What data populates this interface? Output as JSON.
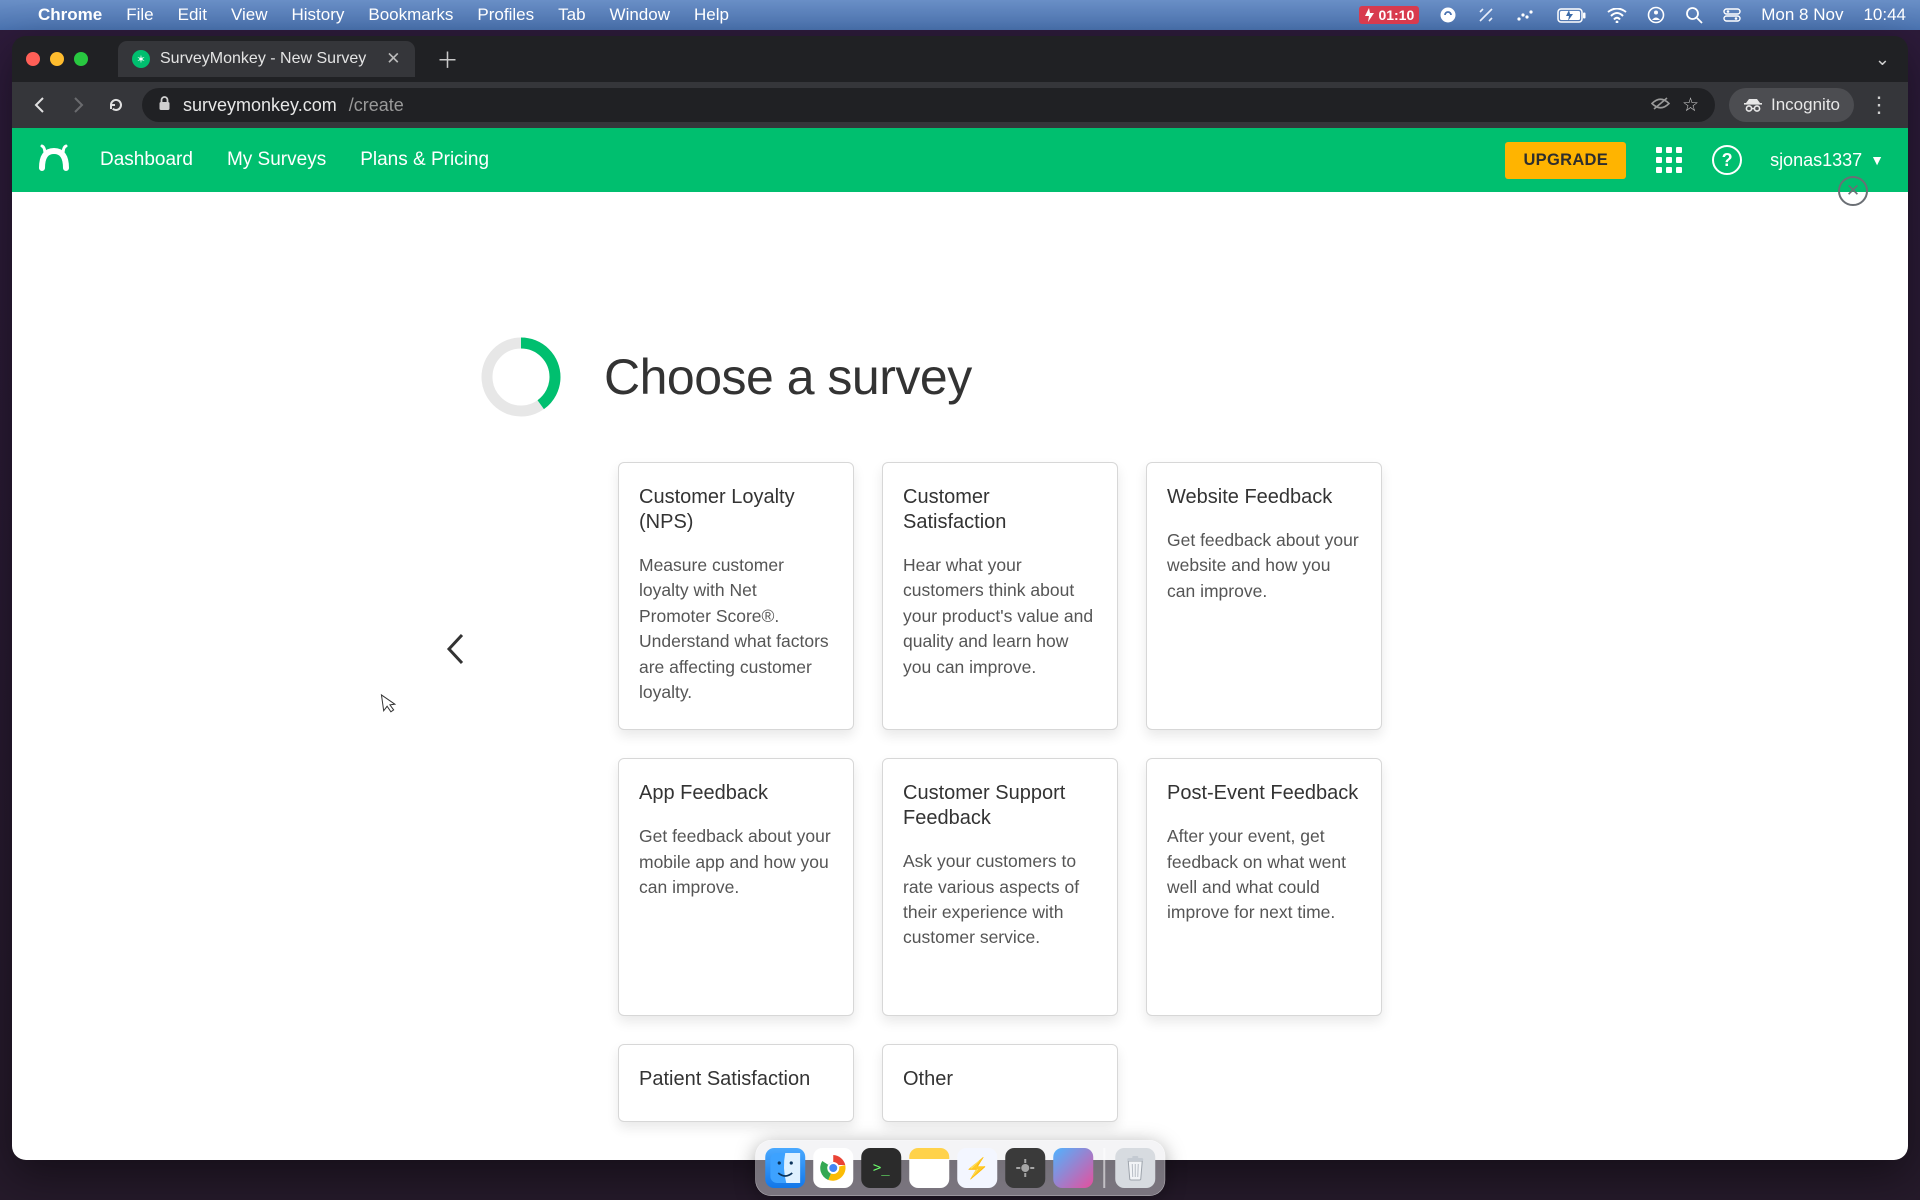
{
  "menubar": {
    "app": "Chrome",
    "items": [
      "File",
      "Edit",
      "View",
      "History",
      "Bookmarks",
      "Profiles",
      "Tab",
      "Window",
      "Help"
    ],
    "battery_timer": "01:10",
    "date": "Mon 8 Nov",
    "time": "10:44"
  },
  "browser": {
    "tab_title": "SurveyMonkey - New Survey",
    "domain": "surveymonkey.com",
    "path": "/create",
    "incognito_label": "Incognito"
  },
  "header": {
    "nav": [
      "Dashboard",
      "My Surveys",
      "Plans & Pricing"
    ],
    "upgrade": "UPGRADE",
    "username": "sjonas1337"
  },
  "page": {
    "title": "Choose a survey",
    "cards": [
      {
        "title": "Customer Loyalty (NPS)",
        "desc": "Measure customer loyalty with Net Promoter Score®. Understand what factors are affecting customer loyalty."
      },
      {
        "title": "Customer Satisfaction",
        "desc": "Hear what your customers think about your product's value and quality and learn how you can improve."
      },
      {
        "title": "Website Feedback",
        "desc": "Get feedback about your website and how you can improve."
      },
      {
        "title": "App Feedback",
        "desc": "Get feedback about your mobile app and how you can improve."
      },
      {
        "title": "Customer Support Feedback",
        "desc": "Ask your customers to rate various aspects of their experience with customer service."
      },
      {
        "title": "Post-Event Feedback",
        "desc": "After your event, get feedback on what went well and what could improve for next time."
      },
      {
        "title": "Patient Satisfaction",
        "desc": ""
      },
      {
        "title": "Other",
        "desc": ""
      }
    ]
  }
}
